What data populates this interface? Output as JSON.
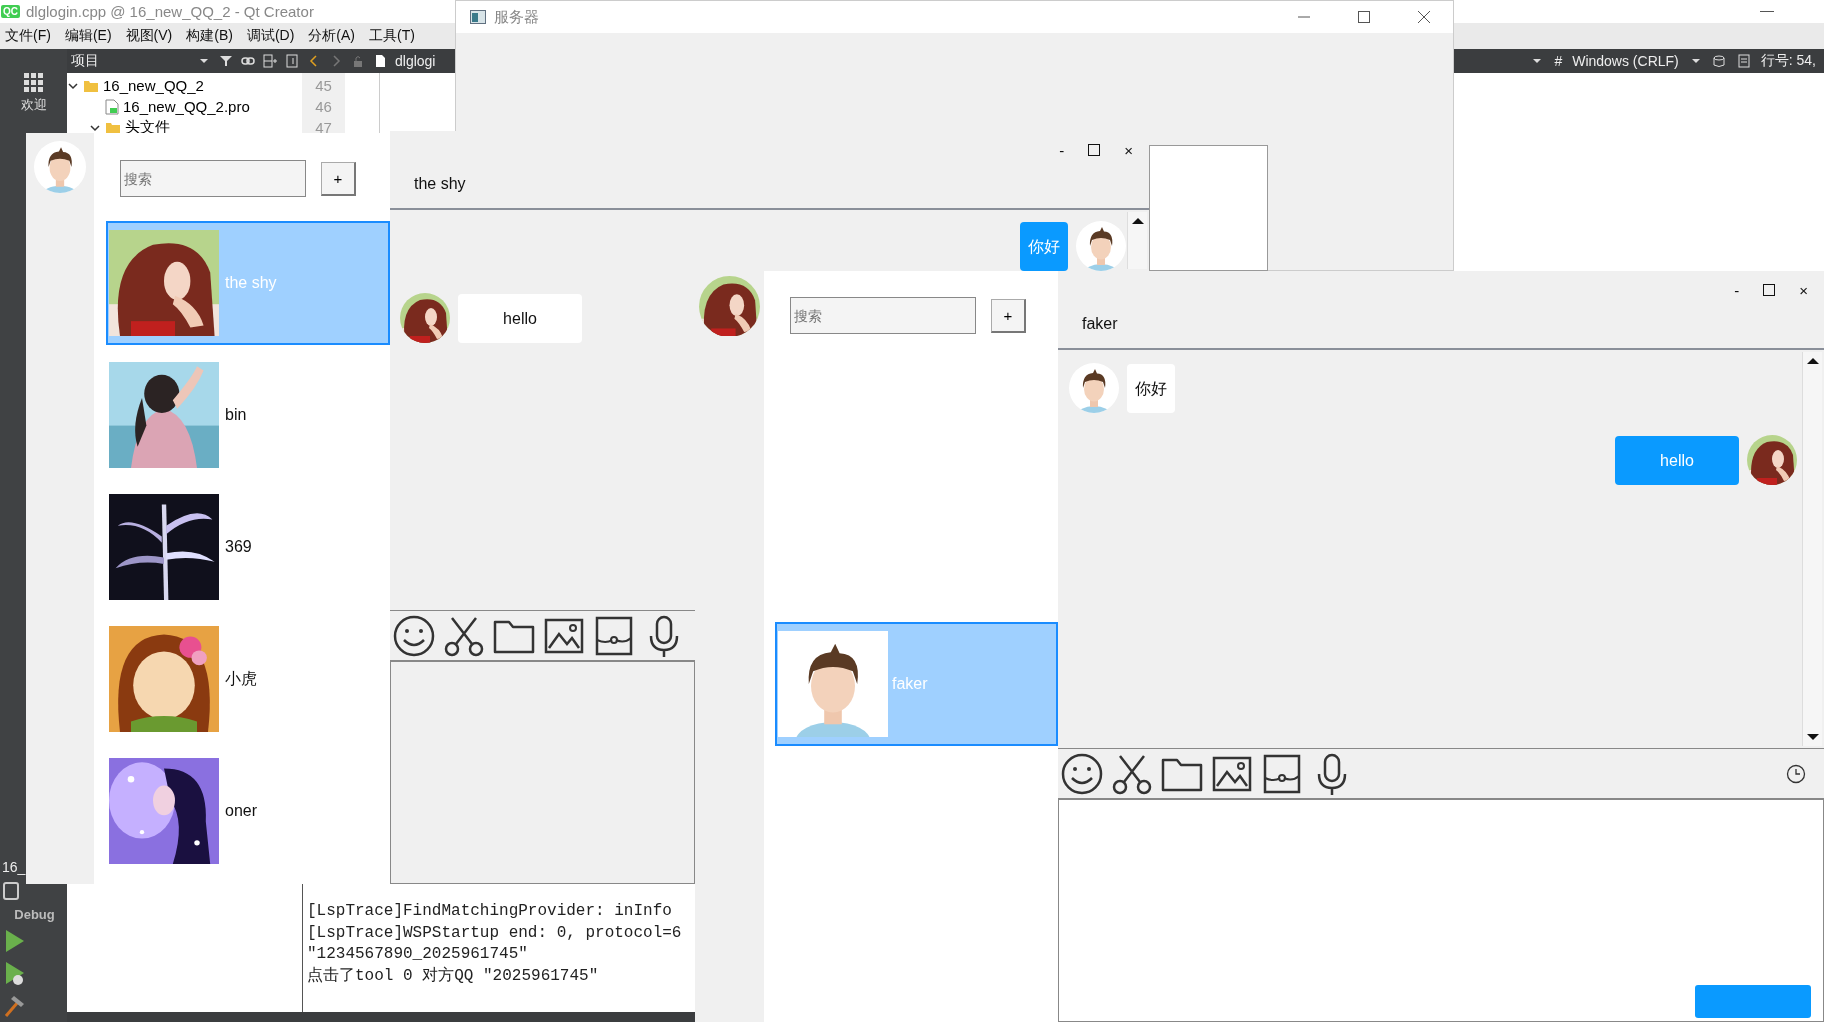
{
  "ide": {
    "logo": "QC",
    "title": "dlglogin.cpp @ 16_new_QQ_2 - Qt Creator",
    "menu": [
      "文件(F)",
      "编辑(E)",
      "视图(V)",
      "构建(B)",
      "调试(D)",
      "分析(A)",
      "工具(T)"
    ],
    "mode_bar": {
      "welcome": "欢迎",
      "project": "16_",
      "build": "Debug"
    },
    "projects_pane": {
      "title": "项目",
      "tree": [
        {
          "label": "16_new_QQ_2",
          "expanded": true,
          "children": [
            {
              "label": "16_new_QQ_2.pro"
            },
            {
              "label": "头文件",
              "expanded": true
            }
          ]
        }
      ]
    },
    "editor": {
      "file": "dlglogi",
      "line_numbers": [
        "45",
        "46",
        "47"
      ]
    },
    "status": {
      "hash": "#",
      "line_ending": "Windows (CRLF)",
      "position": "行号: 54,"
    },
    "output": [
      "[LspTrace]FindMatchingProvider: inInfo",
      "[LspTrace]WSPStartup end: 0, protocol=6",
      "\"1234567890_2025961745\"",
      "点击了tool 0 对方QQ \"2025961745\""
    ]
  },
  "server_window": {
    "title": "服务器"
  },
  "contacts_window": {
    "search": {
      "placeholder": "搜索"
    },
    "add": "+",
    "contacts": [
      {
        "name": "the shy",
        "selected": true
      },
      {
        "name": "bin",
        "selected": false
      },
      {
        "name": "369",
        "selected": false
      },
      {
        "name": "小虎",
        "selected": false
      },
      {
        "name": "oner",
        "selected": false
      }
    ]
  },
  "chat_windows": [
    {
      "title": "the shy",
      "minimize": "-",
      "close": "×",
      "messages": [
        {
          "outgoing": true,
          "text": "你好"
        },
        {
          "outgoing": false,
          "text": "hello"
        }
      ]
    },
    {
      "title": "faker",
      "minimize": "-",
      "close": "×",
      "contact_list": {
        "search": {
          "placeholder": "搜索"
        },
        "add": "+",
        "contacts": [
          {
            "name": "faker",
            "selected": true
          }
        ]
      },
      "messages": [
        {
          "outgoing": false,
          "text": "你好"
        },
        {
          "outgoing": true,
          "text": "hello"
        }
      ]
    }
  ]
}
